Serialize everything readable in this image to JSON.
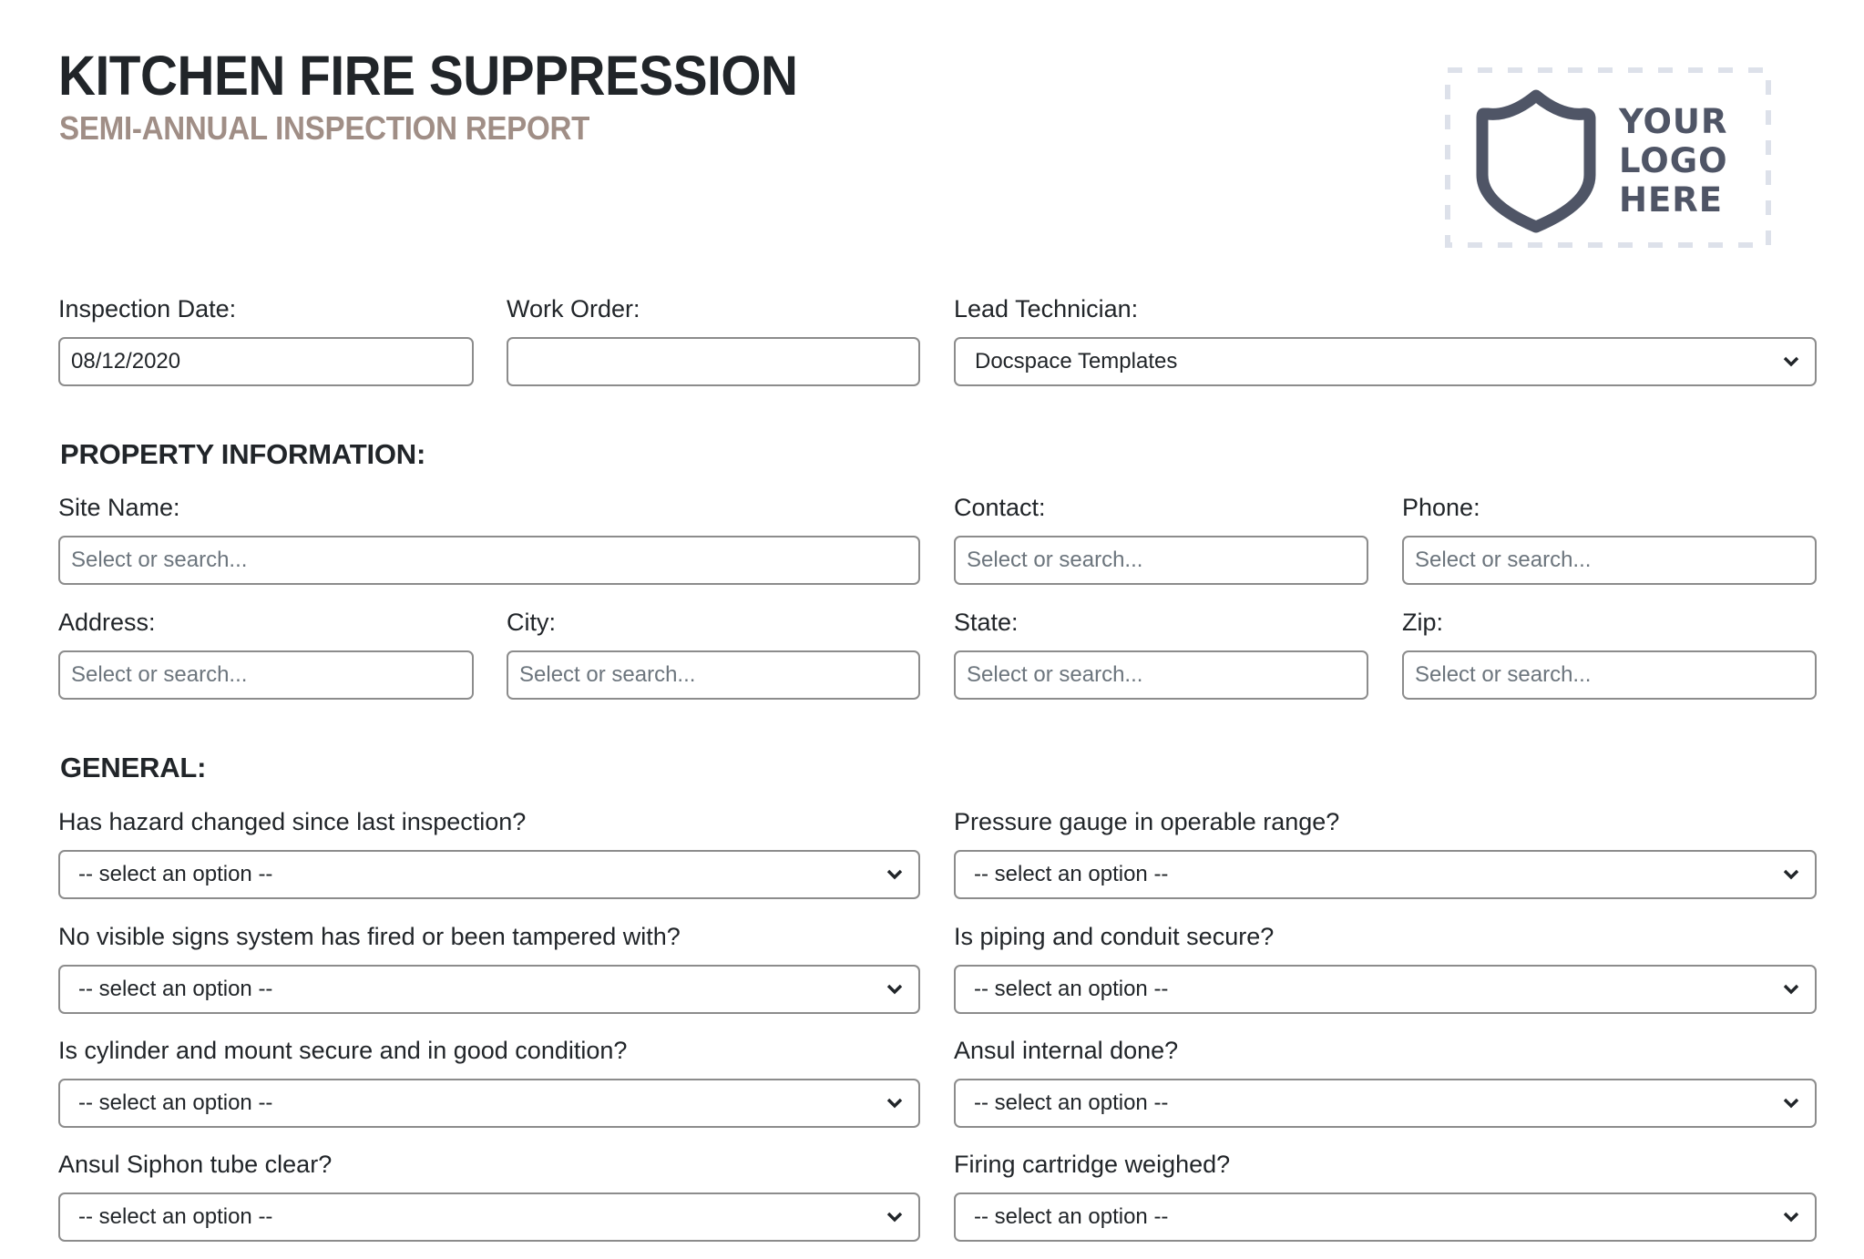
{
  "header": {
    "title": "KITCHEN FIRE SUPPRESSION",
    "subtitle": "SEMI-ANNUAL INSPECTION REPORT",
    "title_color": "#212529",
    "subtitle_color": "#a08e86",
    "logo": {
      "lines": [
        "YOUR",
        "LOGO",
        "HERE"
      ],
      "icon": "shield-icon",
      "color": "#4f5566",
      "dash_color": "#dde1ea"
    }
  },
  "inspection": {
    "date_label": "Inspection Date:",
    "date_value": "08/12/2020",
    "work_order_label": "Work Order:",
    "work_order_value": "",
    "lead_technician_label": "Lead Technician:",
    "lead_technician_value": "Docspace Templates"
  },
  "property": {
    "heading": "PROPERTY INFORMATION:",
    "placeholder": "Select or search...",
    "site_name_label": "Site Name:",
    "contact_label": "Contact:",
    "phone_label": "Phone:",
    "address_label": "Address:",
    "city_label": "City:",
    "state_label": "State:",
    "zip_label": "Zip:"
  },
  "general": {
    "heading": "GENERAL:",
    "default_option": "-- select an option --",
    "questions": [
      "Has hazard changed since last inspection?",
      "Pressure gauge in operable range?",
      "No visible signs system has fired or been tampered with?",
      "Is piping and conduit secure?",
      "Is cylinder and mount secure and in good condition?",
      "Ansul internal done?",
      "Ansul Siphon tube clear?",
      "Firing cartridge weighed?"
    ]
  }
}
